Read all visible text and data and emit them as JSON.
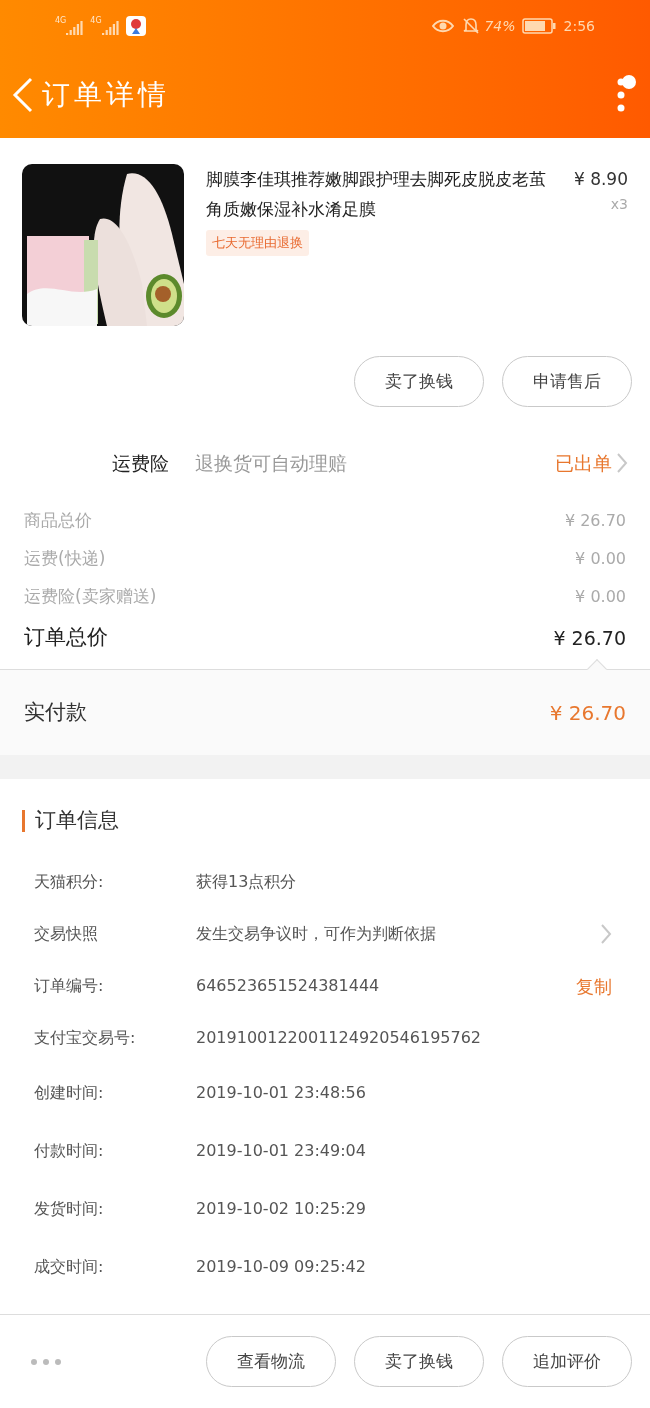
{
  "status_bar": {
    "network_labels": [
      "4G",
      "4G"
    ],
    "battery_percent": "74%",
    "time": "2:56"
  },
  "header": {
    "title": "订单详情"
  },
  "product": {
    "name": "脚膜李佳琪推荐嫩脚跟护理去脚死皮脱皮老茧角质嫩保湿补水淆足膜",
    "price": "¥ 8.90",
    "quantity": "x3",
    "tag": "七天无理由退换",
    "actions": [
      "卖了换钱",
      "申请售后"
    ]
  },
  "insurance": {
    "label": "运费险",
    "description": "退换货可自动理赔",
    "status": "已出单"
  },
  "price_lines": [
    {
      "label": "商品总价",
      "value": "¥ 26.70"
    },
    {
      "label": "运费(快递)",
      "value": "¥ 0.00"
    },
    {
      "label": "运费险(卖家赠送)",
      "value": "¥ 0.00"
    }
  ],
  "order_total": {
    "label": "订单总价",
    "value": "¥ 26.70"
  },
  "paid": {
    "label": "实付款",
    "value": "¥ 26.70"
  },
  "order_info": {
    "title": "订单信息",
    "rows": [
      {
        "kind": "plain",
        "label": "天猫积分:",
        "value": "获得13点积分"
      },
      {
        "kind": "link",
        "label": "交易快照",
        "value": "发生交易争议时，可作为判断依据"
      },
      {
        "kind": "copy",
        "label": "订单编号:",
        "value": "646523651524381444",
        "action": "复制"
      },
      {
        "kind": "plain",
        "label": "支付宝交易号:",
        "value": "2019100122001124920546195762"
      },
      {
        "kind": "plain",
        "label": "创建时间:",
        "value": "2019-10-01 23:48:56"
      },
      {
        "kind": "plain",
        "label": "付款时间:",
        "value": "2019-10-01 23:49:04"
      },
      {
        "kind": "plain",
        "label": "发货时间:",
        "value": "2019-10-02 10:25:29"
      },
      {
        "kind": "plain",
        "label": "成交时间:",
        "value": "2019-10-09 09:25:42"
      }
    ]
  },
  "bottom_bar": {
    "actions": [
      "查看物流",
      "卖了换钱",
      "追加评价"
    ]
  }
}
